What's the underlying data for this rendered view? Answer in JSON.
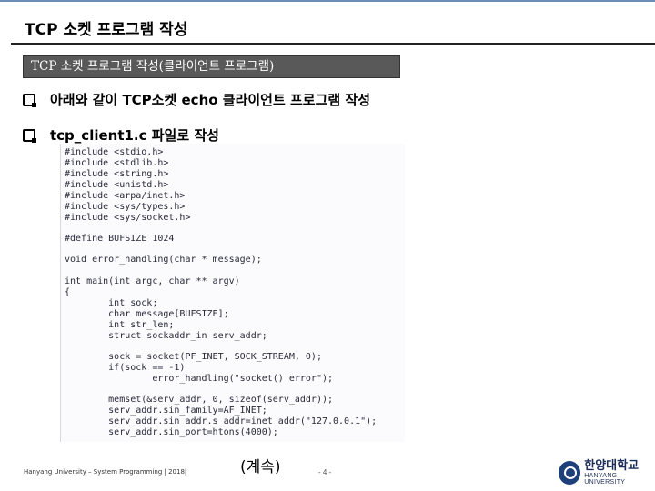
{
  "slide": {
    "title": "TCP 소켓 프로그램 작성",
    "section": "TCP 소켓 프로그램 작성(클라이언트 프로그램)",
    "bullets": [
      "아래와 같이 TCP소켓 echo 클라이언트 프로그램 작성",
      "tcp_client1.c 파일로 작성"
    ]
  },
  "code_lines": [
    "#include <stdio.h>",
    "#include <stdlib.h>",
    "#include <string.h>",
    "#include <unistd.h>",
    "#include <arpa/inet.h>",
    "#include <sys/types.h>",
    "#include <sys/socket.h>",
    "#define BUFSIZE 1024",
    "void error_handling(char * message);",
    "int main(int argc, char ** argv)",
    "{",
    "        int sock;",
    "        char message[BUFSIZE];",
    "        int str_len;",
    "        struct sockaddr_in serv_addr;",
    "        sock = socket(PF_INET, SOCK_STREAM, 0);",
    "        if(sock == -1)",
    "                error_handling(\"socket() error\");",
    "        memset(&serv_addr, 0, sizeof(serv_addr));",
    "        serv_addr.sin_family=AF_INET;",
    "        serv_addr.sin_addr.s_addr=inet_addr(\"127.0.0.1\");",
    "        serv_addr.sin_port=htons(4000);"
  ],
  "footer": {
    "left": "Hanyang University – System Programming | 2018|",
    "center": "(계속)",
    "page": "- 4 -",
    "logo_ko": "한양대학교",
    "logo_en": "HANYANG UNIVERSITY"
  },
  "colors": {
    "section_bar": "#595959",
    "top_line": "#6b8fb5",
    "logo": "#1d3f7a"
  }
}
